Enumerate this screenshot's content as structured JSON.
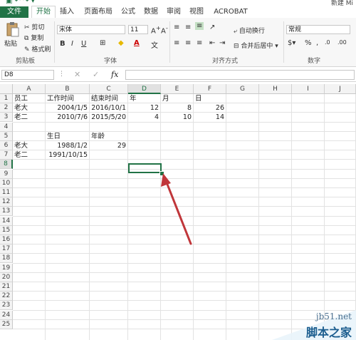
{
  "window": {
    "title": "新建 Mi"
  },
  "tabs": [
    "文件",
    "开始",
    "插入",
    "页面布局",
    "公式",
    "数据",
    "审阅",
    "视图",
    "ACROBAT"
  ],
  "ribbon": {
    "paste_label": "粘贴",
    "cut_label": "剪切",
    "copy_label": "复制",
    "format_painter_label": "格式刷",
    "clipboard_group": "剪贴板",
    "font_name": "宋体",
    "font_size": "11",
    "font_group": "字体",
    "wrap_text_label": "自动换行",
    "merge_center_label": "合并后居中",
    "alignment_group": "对齐方式",
    "number_format": "常规",
    "number_group": "数字"
  },
  "formula_bar": {
    "name_box": "D8",
    "fx": "fx"
  },
  "columns": [
    "A",
    "B",
    "C",
    "D",
    "E",
    "F",
    "G",
    "H",
    "I",
    "J"
  ],
  "rows": [
    "1",
    "2",
    "3",
    "4",
    "5",
    "6",
    "7",
    "8",
    "9",
    "10",
    "11",
    "12",
    "13",
    "14",
    "15",
    "16",
    "17",
    "18",
    "19",
    "20",
    "21",
    "22",
    "23",
    "24",
    "25"
  ],
  "cells": {
    "A1": "员工",
    "B1": "工作时间",
    "C1": "结束时间",
    "D1": "年",
    "E1": "月",
    "F1": "日",
    "A2": "老大",
    "B2": "2004/1/5",
    "C2": "2016/10/1",
    "D2": "12",
    "E2": "8",
    "F2": "26",
    "A3": "老二",
    "B3": "2010/7/6",
    "C3": "2015/5/20",
    "D3": "4",
    "E3": "10",
    "F3": "14",
    "B5": "生日",
    "C5": "年龄",
    "A6": "老大",
    "B6": "1988/1/2",
    "C6": "29",
    "A7": "老二",
    "B7": "1991/10/15"
  },
  "watermark": {
    "site": "jb51.net",
    "name": "脚本之家"
  },
  "colors": {
    "accent": "#217346",
    "arrow": "#c0363a"
  }
}
